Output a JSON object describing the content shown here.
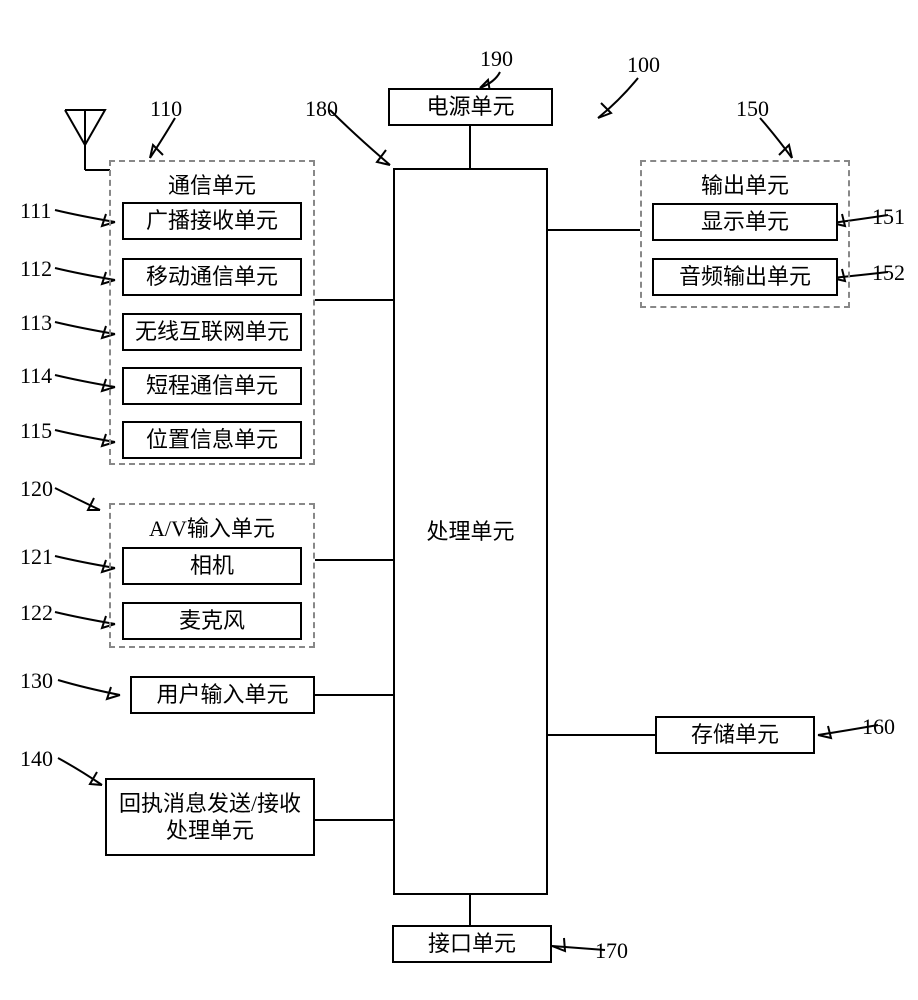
{
  "refs": {
    "r190": "190",
    "r100": "100",
    "r180": "180",
    "r110": "110",
    "r111": "111",
    "r112": "112",
    "r113": "113",
    "r114": "114",
    "r115": "115",
    "r120": "120",
    "r121": "121",
    "r122": "122",
    "r130": "130",
    "r140": "140",
    "r150": "150",
    "r151": "151",
    "r152": "152",
    "r160": "160",
    "r170": "170"
  },
  "blocks": {
    "power_unit": "电源单元",
    "processing_unit": "处理单元",
    "comm_unit_title": "通信单元",
    "broadcast_rx": "广播接收单元",
    "mobile_comm": "移动通信单元",
    "wireless_internet": "无线互联网单元",
    "short_range_comm": "短程通信单元",
    "location_info": "位置信息单元",
    "av_unit_title": "A/V输入单元",
    "camera": "相机",
    "microphone": "麦克风",
    "user_input": "用户输入单元",
    "receipt_proc": "回执消息发送/接收处理单元",
    "output_unit_title": "输出单元",
    "display_unit": "显示单元",
    "audio_out": "音频输出单元",
    "storage_unit": "存储单元",
    "interface_unit": "接口单元"
  }
}
